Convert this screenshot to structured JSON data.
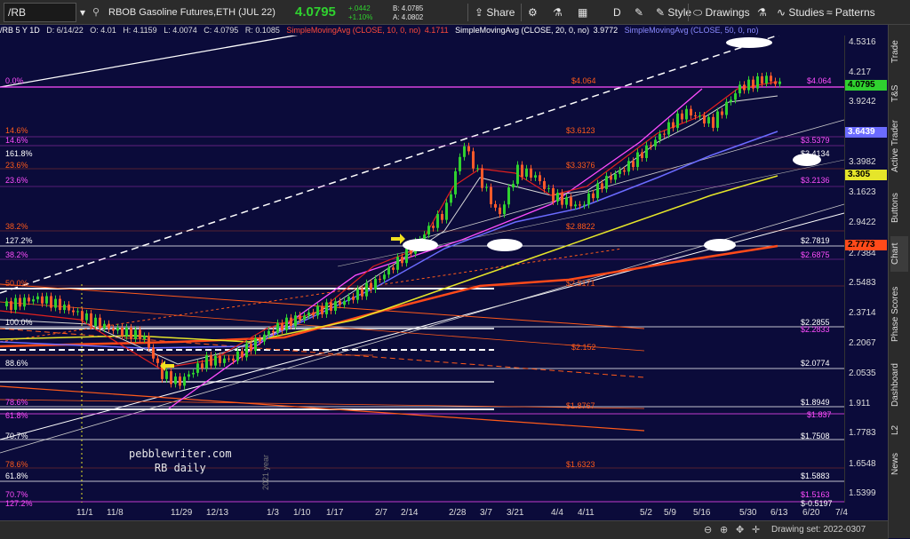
{
  "toolbar": {
    "symbol": "/RB",
    "description": "RBOB Gasoline Futures,ETH (JUL 22)",
    "last": "4.0795",
    "change": "+.0442",
    "change_pct": "+1.10%",
    "bid": "B: 4.0785",
    "ask": "A: 4.0802",
    "share_label": "Share",
    "period_label": "D",
    "style_label": "Style",
    "drawings_label": "Drawings",
    "studies_label": "Studies",
    "patterns_label": "Patterns"
  },
  "infobar": {
    "symbol_period": "/RB 5 Y 1D",
    "date": "D: 6/14/22",
    "open": "O: 4.01",
    "high": "H: 4.1159",
    "low": "L: 4.0074",
    "close": "C: 4.0795",
    "range": "R: 0.1085",
    "sma10_label": "SimpleMovingAvg (CLOSE, 10, 0, no)",
    "sma10_value": "4.1711",
    "sma20_label": "SimpleMovingAvg (CLOSE, 20, 0, no)",
    "sma20_value": "3.9772",
    "sma50_label": "SimpleMovingAvg (CLOSE, 50, 0, no)"
  },
  "sidebar": {
    "tabs": [
      "Trade",
      "T&S",
      "Active Trader",
      "Buttons",
      "Chart",
      "Phase Scores",
      "Dashboard",
      "L2",
      "News"
    ]
  },
  "yaxis": {
    "labels": [
      "4.5316",
      "4.217",
      "3.9242",
      "3.3982",
      "3.1623",
      "2.9422",
      "2.7384",
      "2.5483",
      "2.3714",
      "2.2067",
      "2.0535",
      "1.911",
      "1.7783",
      "1.6548",
      "1.5399"
    ],
    "tags": {
      "last": "4.0795",
      "sma50": "3.6439",
      "yellow": "3.305",
      "red": "2.7773"
    }
  },
  "xaxis": {
    "labels": [
      "11/1",
      "11/8",
      "11/29",
      "12/13",
      "1/3",
      "1/10",
      "1/17",
      "2/7",
      "2/14",
      "2/28",
      "3/7",
      "3/21",
      "4/4",
      "4/11",
      "5/2",
      "5/9",
      "5/16",
      "5/30",
      "6/13",
      "6/20",
      "7/4"
    ],
    "year_marker": "2021 year"
  },
  "fib_left": [
    "0.0%",
    "14.6%",
    "14.6%",
    "161.8%",
    "23.6%",
    "23.6%",
    "38.2%",
    "127.2%",
    "38.2%",
    "50.0%",
    "100.0%",
    "88.6%",
    "78.6%",
    "61.8%",
    "70.7%",
    "78.6%",
    "61.8%",
    "70.7%",
    "127.2%"
  ],
  "levels_orange": [
    "$4.064",
    "$3.6123",
    "$3.3376",
    "$2.8822",
    "$2.5171",
    "$2.152",
    "$1.8767",
    "$1.6323"
  ],
  "levels_white": [
    "$3.4134",
    "$2.7819",
    "$2.2855",
    "$2.0774",
    "$1.8949",
    "$1.7508",
    "$1.5883",
    "$-0.5197"
  ],
  "levels_magenta": [
    "$4.064",
    "$3.5379",
    "$3.2136",
    "$2.6875",
    "$2.2833",
    "$1.837",
    "$1.5163"
  ],
  "watermark": {
    "line1": "pebblewriter.com",
    "line2": "RB daily"
  },
  "bottombar": {
    "drawing_set": "Drawing set: 2022-0307"
  },
  "colors": {
    "background": "#0b0b3a",
    "candle_up": "#2fd12f",
    "candle_down": "#ff5a2a",
    "sma10": "#e0201e",
    "sma20": "#d8d8d8",
    "sma50": "#6b6bff",
    "sma_yellow": "#e5e52a",
    "sma_red": "#ff4a1a",
    "fib_magenta": "#ff4dff",
    "fib_orange": "#ff5a1a"
  }
}
